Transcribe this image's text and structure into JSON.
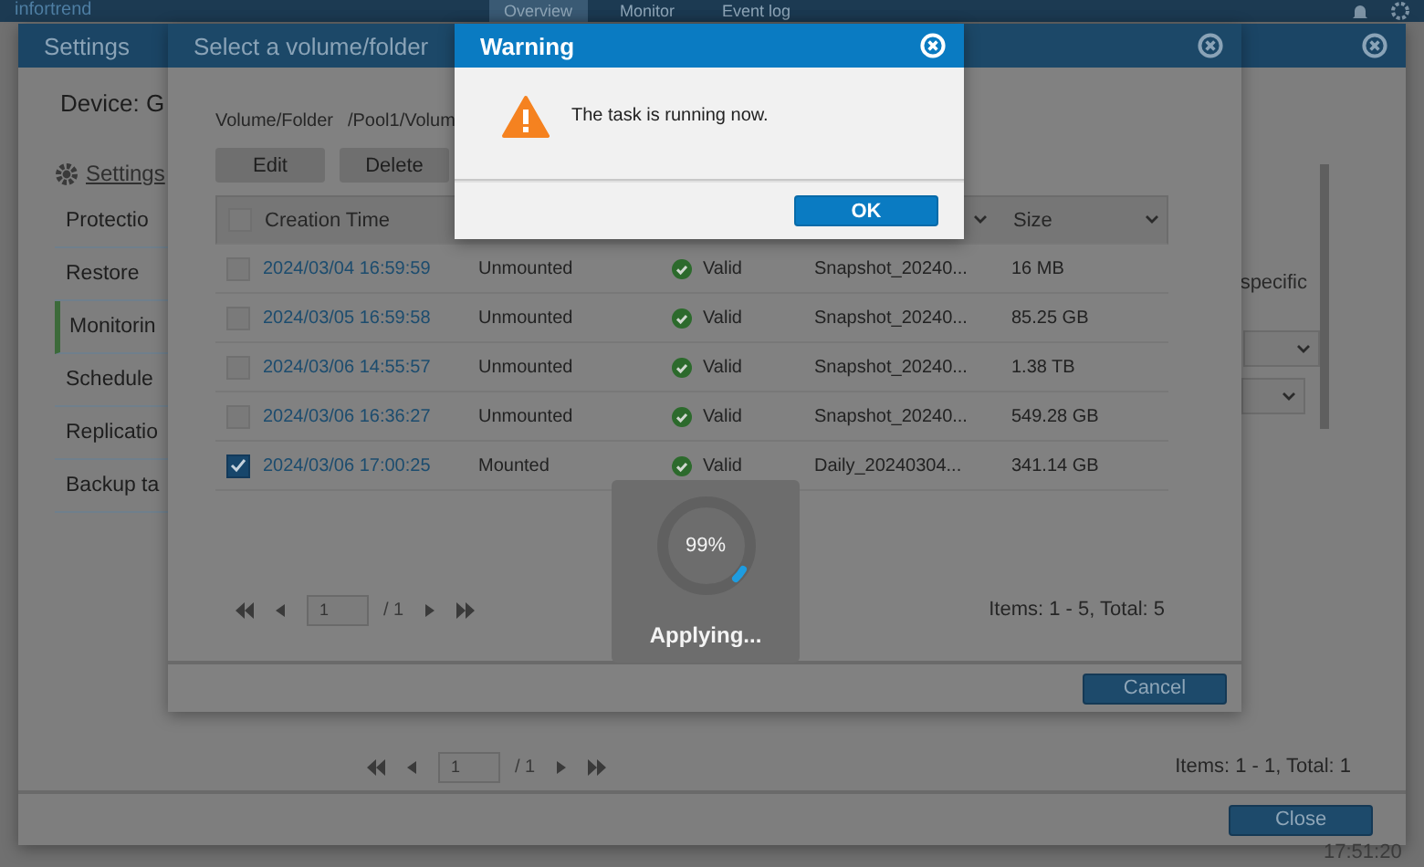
{
  "top_bar": {
    "logo": "infortrend",
    "tabs": [
      {
        "label": "Overview",
        "selected": true
      },
      {
        "label": "Monitor",
        "selected": false
      },
      {
        "label": "Event log",
        "selected": false
      }
    ]
  },
  "settings_window": {
    "title": "Settings",
    "device": "Device: G",
    "settings_link": "Settings",
    "sidebar": [
      {
        "label": "Protectio",
        "selected": false
      },
      {
        "label": "Restore",
        "selected": false
      },
      {
        "label": "Monitorin",
        "selected": true
      },
      {
        "label": "Schedule",
        "selected": false
      },
      {
        "label": "Replicatio",
        "selected": false
      },
      {
        "label": "Backup ta",
        "selected": false
      }
    ],
    "right_text": "specific",
    "pagination": {
      "page": "1",
      "of": "/ 1"
    },
    "items": "Items: 1 - 1, Total: 1",
    "close_button": "Close"
  },
  "clock": "17:51:20",
  "volume_dialog": {
    "title": "Select a volume/folder",
    "path_label": "Volume/Folder",
    "path": "/Pool1/Volum",
    "buttons": [
      "Edit",
      "Delete"
    ],
    "select_all_checked": false,
    "columns": [
      {
        "label": "Creation Time",
        "kind": "sort"
      },
      {
        "kind": "blank"
      },
      {
        "kind": "blank"
      },
      {
        "kind": "menu"
      },
      {
        "label": "Size",
        "kind": "menu"
      }
    ],
    "rows": [
      {
        "checked": false,
        "time": "2024/03/04 16:59:59",
        "mount": "Unmounted",
        "validity": "Valid",
        "name": "Snapshot_20240...",
        "size": "16 MB"
      },
      {
        "checked": false,
        "time": "2024/03/05 16:59:58",
        "mount": "Unmounted",
        "validity": "Valid",
        "name": "Snapshot_20240...",
        "size": "85.25 GB"
      },
      {
        "checked": false,
        "time": "2024/03/06 14:55:57",
        "mount": "Unmounted",
        "validity": "Valid",
        "name": "Snapshot_20240...",
        "size": "1.38 TB"
      },
      {
        "checked": false,
        "time": "2024/03/06 16:36:27",
        "mount": "Unmounted",
        "validity": "Valid",
        "name": "Snapshot_20240...",
        "size": "549.28 GB"
      },
      {
        "checked": true,
        "time": "2024/03/06 17:00:25",
        "mount": "Mounted",
        "validity": "Valid",
        "name": "Daily_20240304...",
        "size": "341.14 GB"
      }
    ],
    "pagination": {
      "page": "1",
      "of": "/ 1"
    },
    "items": "Items: 1 - 5, Total: 5",
    "cancel_button": "Cancel"
  },
  "progress": {
    "percent": "99%",
    "label": "Applying..."
  },
  "warning": {
    "title": "Warning",
    "message": "The task is running now.",
    "ok_button": "OK"
  }
}
